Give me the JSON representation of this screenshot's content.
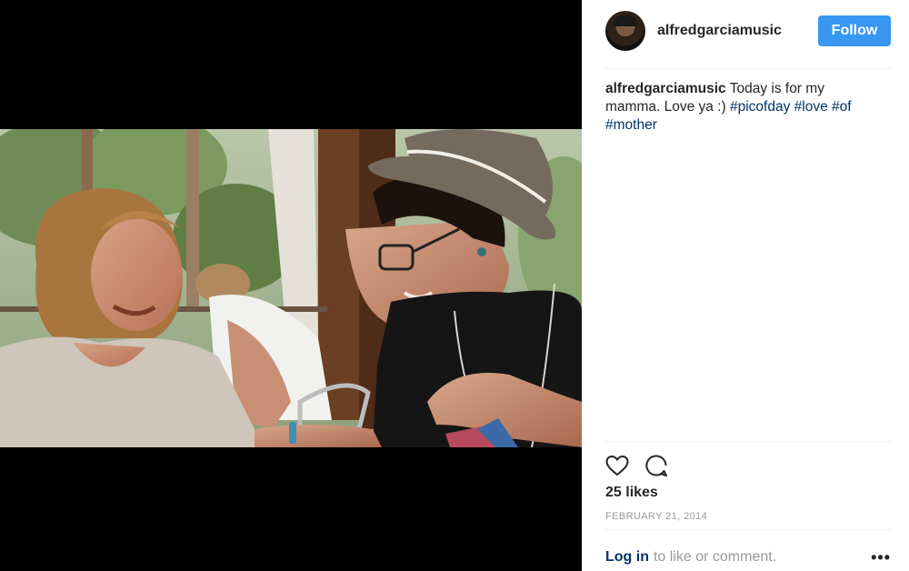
{
  "post": {
    "username": "alfredgarciamusic",
    "follow_label": "Follow",
    "caption_user": "alfredgarciamusic",
    "caption_text": " Today is for my mamma. Love ya :) ",
    "hashtags": [
      "#picofday",
      "#love",
      "#of",
      "#mother"
    ],
    "likes": "25 likes",
    "date": "February 21, 2014",
    "login_label": "Log in",
    "login_suffix": "to like or comment.",
    "more_label": "•••"
  },
  "icons": [
    "heart-icon",
    "comment-icon",
    "more-options-icon"
  ],
  "colors": {
    "follow": "#3897f0",
    "link": "#003569",
    "muted": "#999999"
  }
}
